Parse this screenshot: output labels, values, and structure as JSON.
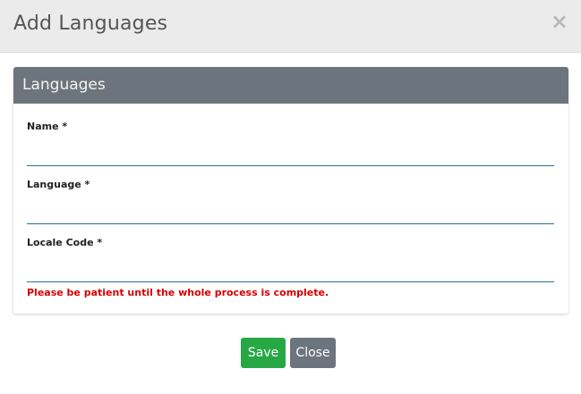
{
  "modal": {
    "title": "Add Languages",
    "close_icon": "×"
  },
  "card": {
    "header": "Languages"
  },
  "fields": {
    "name": {
      "label": "Name *",
      "value": "",
      "placeholder": ""
    },
    "language": {
      "label": "Language *",
      "value": "",
      "placeholder": ""
    },
    "locale_code": {
      "label": "Locale Code *",
      "value": "",
      "placeholder": ""
    }
  },
  "notice": "Please be patient until the whole process is complete.",
  "buttons": {
    "save": "Save",
    "close": "Close"
  },
  "colors": {
    "header_bg": "#ebebeb",
    "card_header_bg": "#6c757d",
    "save": "#28a745",
    "close": "#6c757d",
    "notice": "#d40000",
    "input_underline": "#2a6f97"
  }
}
